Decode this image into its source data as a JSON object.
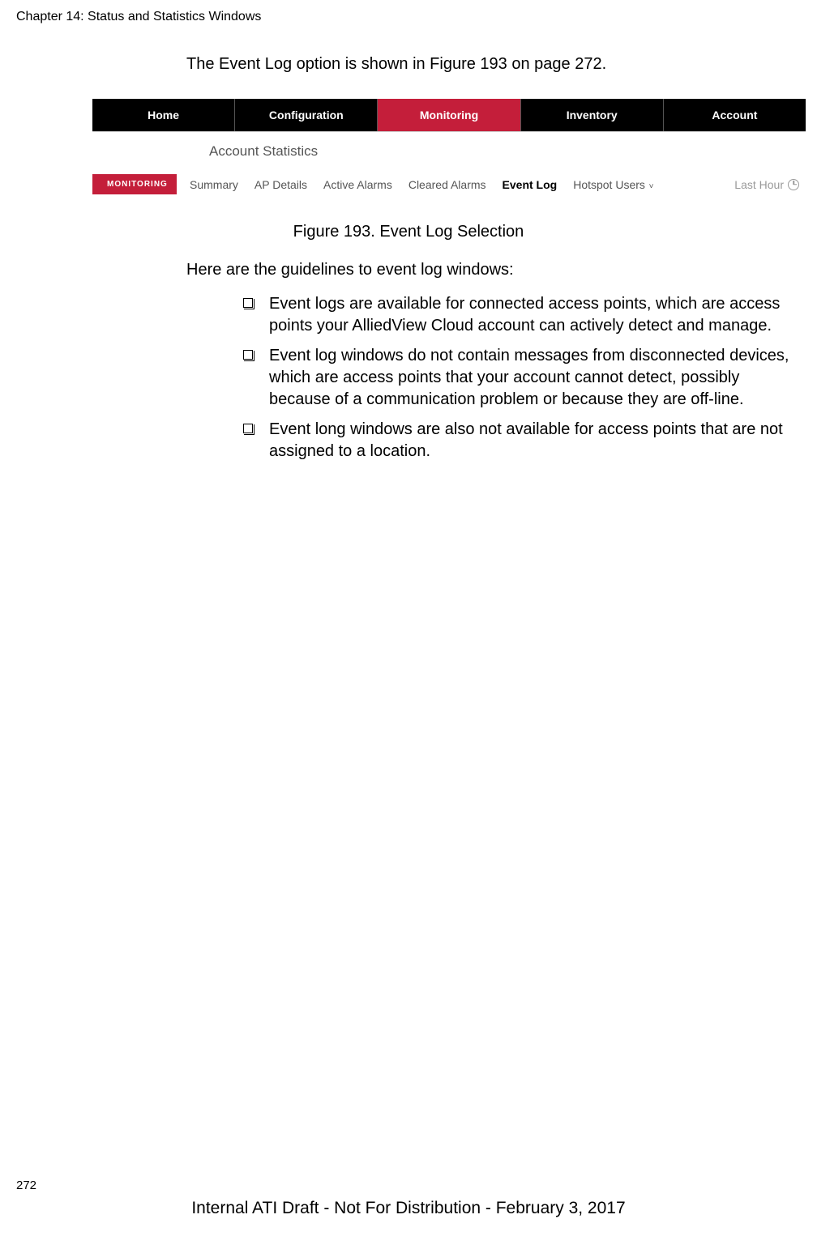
{
  "header": {
    "chapter_title": "Chapter 14: Status and Statistics Windows"
  },
  "intro": "The Event Log option is shown in Figure 193 on page 272.",
  "figure": {
    "nav": {
      "items": [
        {
          "label": "Home",
          "active": false
        },
        {
          "label": "Configuration",
          "active": false
        },
        {
          "label": "Monitoring",
          "active": true
        },
        {
          "label": "Inventory",
          "active": false
        },
        {
          "label": "Account",
          "active": false
        }
      ]
    },
    "title": "Account Statistics",
    "monitoring_label": "MONITORING",
    "sub_tabs": [
      {
        "label": "Summary",
        "active": false
      },
      {
        "label": "AP Details",
        "active": false
      },
      {
        "label": "Active Alarms",
        "active": false
      },
      {
        "label": "Cleared Alarms",
        "active": false
      },
      {
        "label": "Event Log",
        "active": true
      },
      {
        "label": "Hotspot Users",
        "active": false,
        "has_chevron": true
      }
    ],
    "last_hour": "Last Hour",
    "caption": "Figure 193. Event Log Selection"
  },
  "guidelines_intro": "Here are the guidelines to event log windows:",
  "bullets": [
    "Event logs are available for connected access points, which are access points your AlliedView Cloud account can actively detect and manage.",
    "Event log windows do not contain messages from disconnected devices, which are access points that your account cannot detect, possibly because of a communication problem or because they are off-line.",
    "Event long windows are also not available for access points that are not assigned to a location."
  ],
  "page_number": "272",
  "footer": "Internal ATI Draft - Not For Distribution - February 3, 2017"
}
